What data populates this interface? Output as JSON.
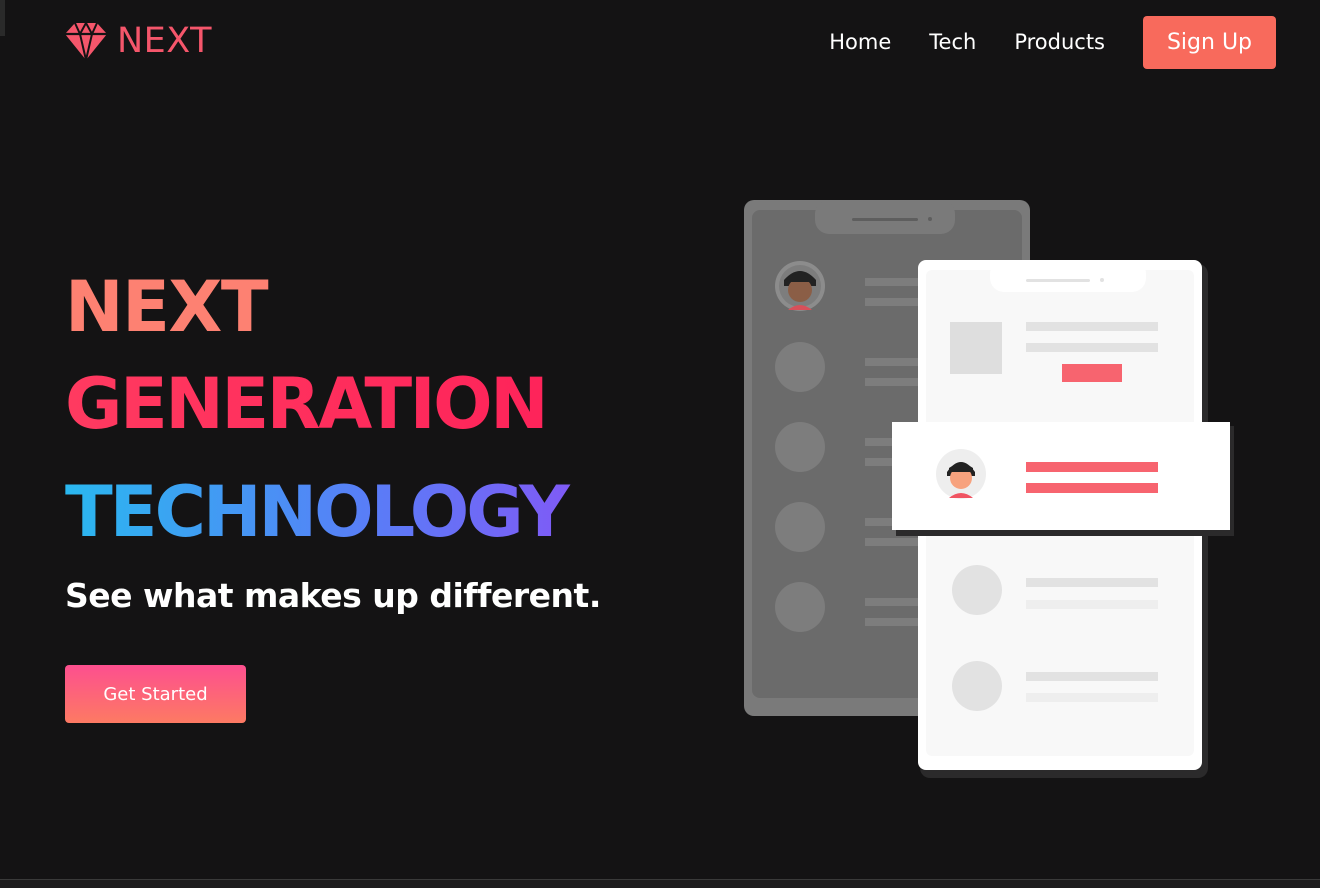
{
  "brand": {
    "logo_text": "NEXT",
    "logo_icon": "diamond-icon",
    "color": "#f5566b"
  },
  "nav": {
    "links": [
      {
        "label": "Home"
      },
      {
        "label": "Tech"
      },
      {
        "label": "Products"
      }
    ],
    "signup_label": "Sign Up",
    "signup_color": "#f86a5c"
  },
  "hero": {
    "line1": "NEXT",
    "line2": "GENERATION",
    "line3": "TECHNOLOGY",
    "subtitle": "See what makes up different.",
    "cta_label": "Get Started",
    "colors": {
      "line1": "#fd8172",
      "line2": "#fe1d58",
      "line3_start": "#2ab8f0",
      "line3_end": "#9547f5",
      "cta_start": "#fd4f8f",
      "cta_end": "#fd7a63"
    }
  },
  "illustration": {
    "name": "phone-mockups",
    "accent": "#f7646f"
  }
}
